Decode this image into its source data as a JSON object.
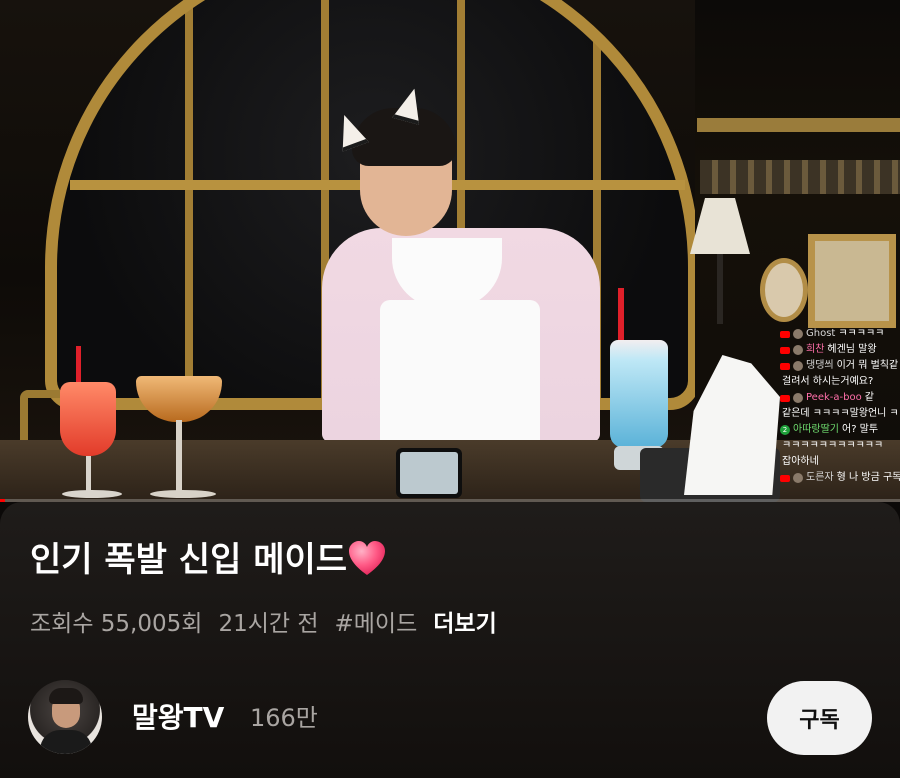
{
  "video": {
    "progress_fraction": 0.005,
    "chat": [
      {
        "badge": "yt",
        "name": "Ghost",
        "message": "ㅋㅋㅋㅋㅋ",
        "name_color": "#d8d8d8"
      },
      {
        "badge": "yt",
        "name": "희찬",
        "message": "헤겐님 말왕",
        "name_color": "#ff6fa9"
      },
      {
        "badge": "yt",
        "name": "댕댕씌",
        "message": "이거 뭐 벌칙같",
        "name_color": "#d8d8d8"
      },
      {
        "badge": "none",
        "name": "",
        "message": "걸려서 하시는거예요?",
        "name_color": "#d8d8d8"
      },
      {
        "badge": "yt",
        "name": "Peek-a-boo",
        "message": "같",
        "name_color": "#ff6fa9"
      },
      {
        "badge": "none",
        "name": "",
        "message": "같은데 ㅋㅋㅋㅋ말왕언니 ㅋㅋ",
        "name_color": "#d8d8d8"
      },
      {
        "badge": "num",
        "name": "아따랑딸기",
        "message": "어? 말투",
        "name_color": "#6fdc6f"
      },
      {
        "badge": "none",
        "name": "",
        "message": "ㅋㅋㅋㅋㅋㅋㅋㅋㅋㅋㅋ",
        "name_color": "#d8d8d8"
      },
      {
        "badge": "none",
        "name": "",
        "message": "잡아하네",
        "name_color": "#d8d8d8"
      },
      {
        "badge": "yt",
        "name": "도른자",
        "message": "형 나 방금 구독",
        "name_color": "#d8d8d8"
      }
    ]
  },
  "info": {
    "title": "인기 폭발 신입 메이드",
    "title_emoji": "heart",
    "views": "조회수 55,005회",
    "time_ago": "21시간 전",
    "hashtag": "#메이드",
    "more_label": "더보기"
  },
  "channel": {
    "name": "말왕TV",
    "subscribers": "166만",
    "subscribe_label": "구독"
  },
  "colors": {
    "accent_red": "#ff0000",
    "panel_bg": "#1a1715",
    "subscribe_bg": "#f2f2f2"
  }
}
